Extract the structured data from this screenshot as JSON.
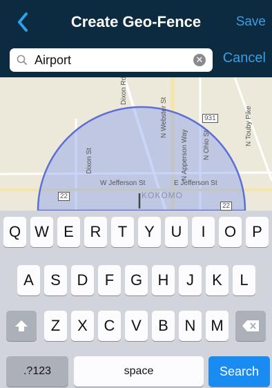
{
  "nav": {
    "title": "Create Geo-Fence",
    "save_label": "Save"
  },
  "search": {
    "value": "Airport",
    "cancel_label": "Cancel"
  },
  "map": {
    "labels": [
      "Dixon Rd",
      "Dixon St",
      "N Webster St",
      "N Apperson Way",
      "N Ohio St",
      "W Jefferson St",
      "E Jefferson St",
      "KOKOMO",
      "N Touby Pike"
    ],
    "shields": [
      "931",
      "22",
      "22"
    ],
    "geofence_color": "#5b6fd6"
  },
  "keyboard": {
    "row1": [
      "Q",
      "W",
      "E",
      "R",
      "T",
      "Y",
      "U",
      "I",
      "O",
      "P"
    ],
    "row2": [
      "A",
      "S",
      "D",
      "F",
      "G",
      "H",
      "J",
      "K",
      "L"
    ],
    "row3": [
      "Z",
      "X",
      "C",
      "V",
      "B",
      "N",
      "M"
    ],
    "numbers_label": ".?123",
    "space_label": "space",
    "search_label": "Search"
  }
}
